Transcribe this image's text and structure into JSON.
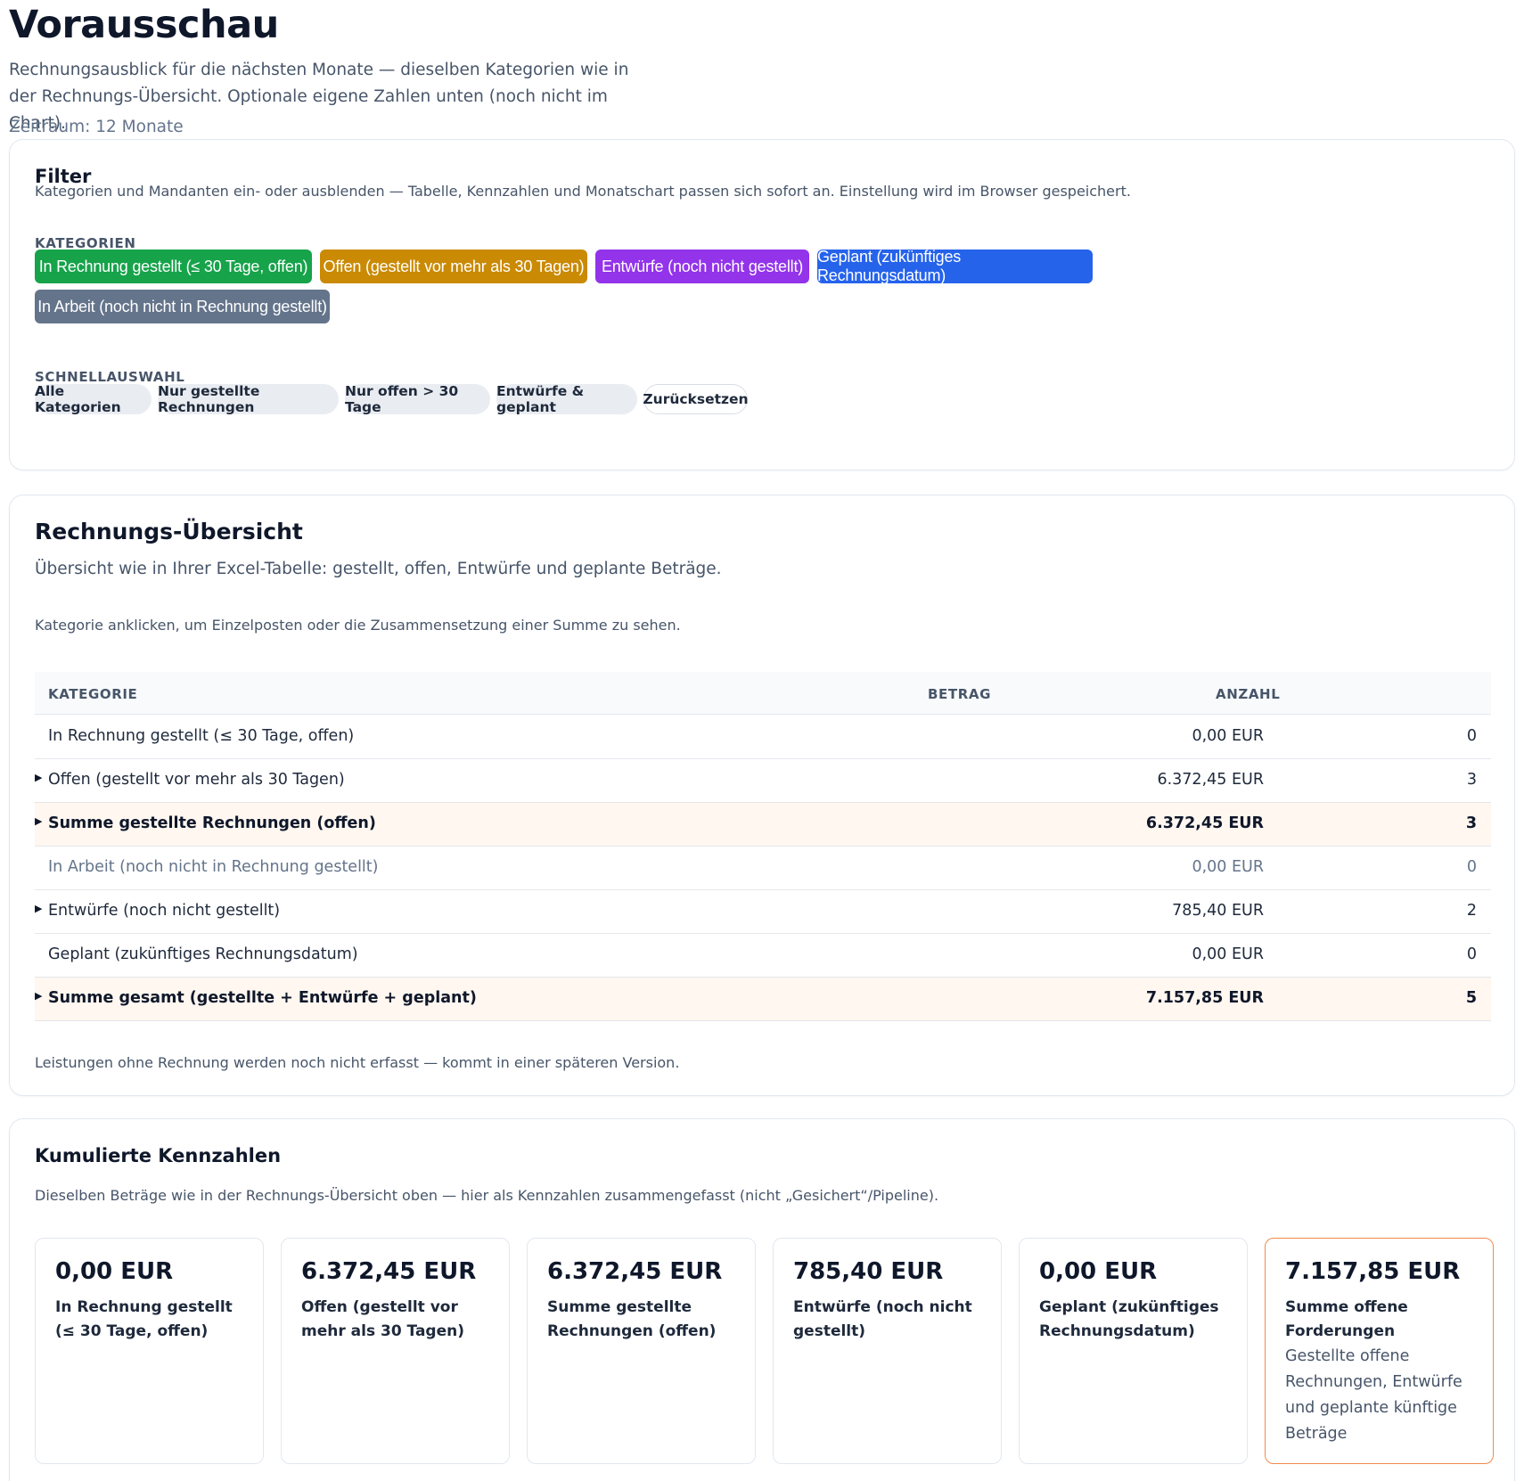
{
  "header": {
    "title": "Vorausschau",
    "subtitle": "Rechnungsausblick für die nächsten Monate — dieselben Kategorien wie in der Rechnungs-Übersicht. Optionale eigene Zahlen unten (noch nicht im Chart).",
    "period": "Zeitraum: 12 Monate"
  },
  "filter": {
    "title": "Filter",
    "description": "Kategorien und Mandanten ein- oder ausblenden — Tabelle, Kennzahlen und Monatschart passen sich sofort an. Einstellung wird im Browser gespeichert.",
    "categories_label": "KATEGORIEN",
    "categories": [
      {
        "label": "In Rechnung gestellt (≤ 30 Tage, offen)",
        "color": "#16a34a"
      },
      {
        "label": "Offen (gestellt vor mehr als 30 Tagen)",
        "color": "#ca8a04"
      },
      {
        "label": "Entwürfe (noch nicht gestellt)",
        "color": "#9333ea"
      },
      {
        "label": "Geplant (zukünftiges Rechnungsdatum)",
        "color": "#2563eb"
      },
      {
        "label": "In Arbeit (noch nicht in Rechnung gestellt)",
        "color": "#64748b"
      }
    ],
    "quick_label": "SCHNELLAUSWAHL",
    "quick": [
      {
        "label": "Alle Kategorien"
      },
      {
        "label": "Nur gestellte Rechnungen"
      },
      {
        "label": "Nur offen > 30 Tage"
      },
      {
        "label": "Entwürfe & geplant"
      },
      {
        "label": "Zurücksetzen"
      }
    ]
  },
  "overview": {
    "title": "Rechnungs-Übersicht",
    "subtitle": "Übersicht wie in Ihrer Excel-Tabelle: gestellt, offen, Entwürfe und geplante Beträge.",
    "hint": "Kategorie anklicken, um Einzelposten oder die Zusammensetzung einer Summe zu sehen.",
    "columns": {
      "category": "KATEGORIE",
      "amount": "BETRAG",
      "count": "ANZAHL"
    },
    "rows": [
      {
        "caret": "",
        "label": "In Rechnung gestellt (≤ 30 Tage, offen)",
        "amount": "0,00 EUR",
        "count": "0"
      },
      {
        "caret": "▶",
        "label": "Offen (gestellt vor mehr als 30 Tagen)",
        "amount": "6.372,45 EUR",
        "count": "3"
      },
      {
        "caret": "▶",
        "label": "Summe gestellte Rechnungen (offen)",
        "amount": "6.372,45 EUR",
        "count": "3"
      },
      {
        "caret": "",
        "label": "In Arbeit (noch nicht in Rechnung gestellt)",
        "amount": "0,00 EUR",
        "count": "0"
      },
      {
        "caret": "▶",
        "label": "Entwürfe (noch nicht gestellt)",
        "amount": "785,40 EUR",
        "count": "2"
      },
      {
        "caret": "",
        "label": "Geplant (zukünftiges Rechnungsdatum)",
        "amount": "0,00 EUR",
        "count": "0"
      },
      {
        "caret": "▶",
        "label": "Summe gesamt (gestellte + Entwürfe + geplant)",
        "amount": "7.157,85 EUR",
        "count": "5"
      }
    ],
    "footer": "Leistungen ohne Rechnung werden noch nicht erfasst — kommt in einer späteren Version."
  },
  "kpis": {
    "title": "Kumulierte Kennzahlen",
    "description": "Dieselben Beträge wie in der Rechnungs-Übersicht oben — hier als Kennzahlen zusammengefasst (nicht „Gesichert“/Pipeline).",
    "cards": [
      {
        "value": "0,00 EUR",
        "label": "In Rechnung gestellt (≤ 30 Tage, offen)",
        "note": ""
      },
      {
        "value": "6.372,45 EUR",
        "label": "Offen (gestellt vor mehr als 30 Tagen)",
        "note": ""
      },
      {
        "value": "6.372,45 EUR",
        "label": "Summe gestellte Rechnungen (offen)",
        "note": ""
      },
      {
        "value": "785,40 EUR",
        "label": "Entwürfe (noch nicht gestellt)",
        "note": ""
      },
      {
        "value": "0,00 EUR",
        "label": "Geplant (zukünftiges Rechnungsdatum)",
        "note": ""
      },
      {
        "value": "7.157,85 EUR",
        "label": "Summe offene Forderungen",
        "note": "Gestellte offene Rechnungen, Entwürfe und geplante künftige Beträge"
      }
    ]
  }
}
